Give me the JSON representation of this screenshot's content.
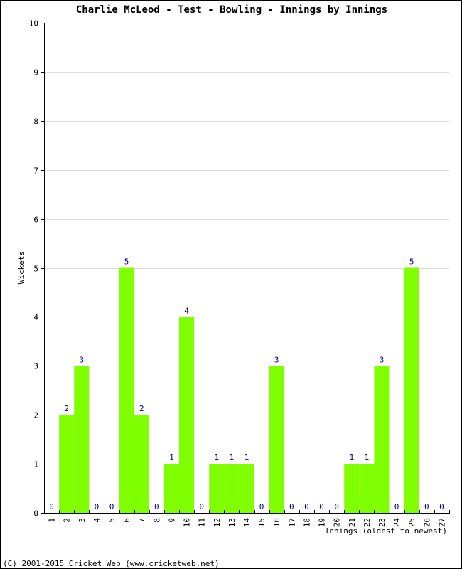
{
  "chart_data": {
    "type": "bar",
    "title": "Charlie McLeod - Test - Bowling - Innings by Innings",
    "xlabel": "Innings (oldest to newest)",
    "ylabel": "Wickets",
    "ylim": [
      0,
      10
    ],
    "yticks": [
      0,
      1,
      2,
      3,
      4,
      5,
      6,
      7,
      8,
      9,
      10
    ],
    "grid": true,
    "categories": [
      "1",
      "2",
      "3",
      "4",
      "5",
      "6",
      "7",
      "8",
      "9",
      "10",
      "11",
      "12",
      "13",
      "14",
      "15",
      "16",
      "17",
      "18",
      "19",
      "20",
      "21",
      "22",
      "23",
      "24",
      "25",
      "26",
      "27"
    ],
    "values": [
      0,
      2,
      3,
      0,
      0,
      5,
      2,
      0,
      1,
      4,
      0,
      1,
      1,
      1,
      0,
      3,
      0,
      0,
      0,
      0,
      1,
      1,
      3,
      0,
      5,
      0,
      0
    ],
    "bar_color": "#80ff00",
    "label_color": "#000080"
  },
  "footer": {
    "copyright": "(C) 2001-2015 Cricket Web (www.cricketweb.net)"
  }
}
